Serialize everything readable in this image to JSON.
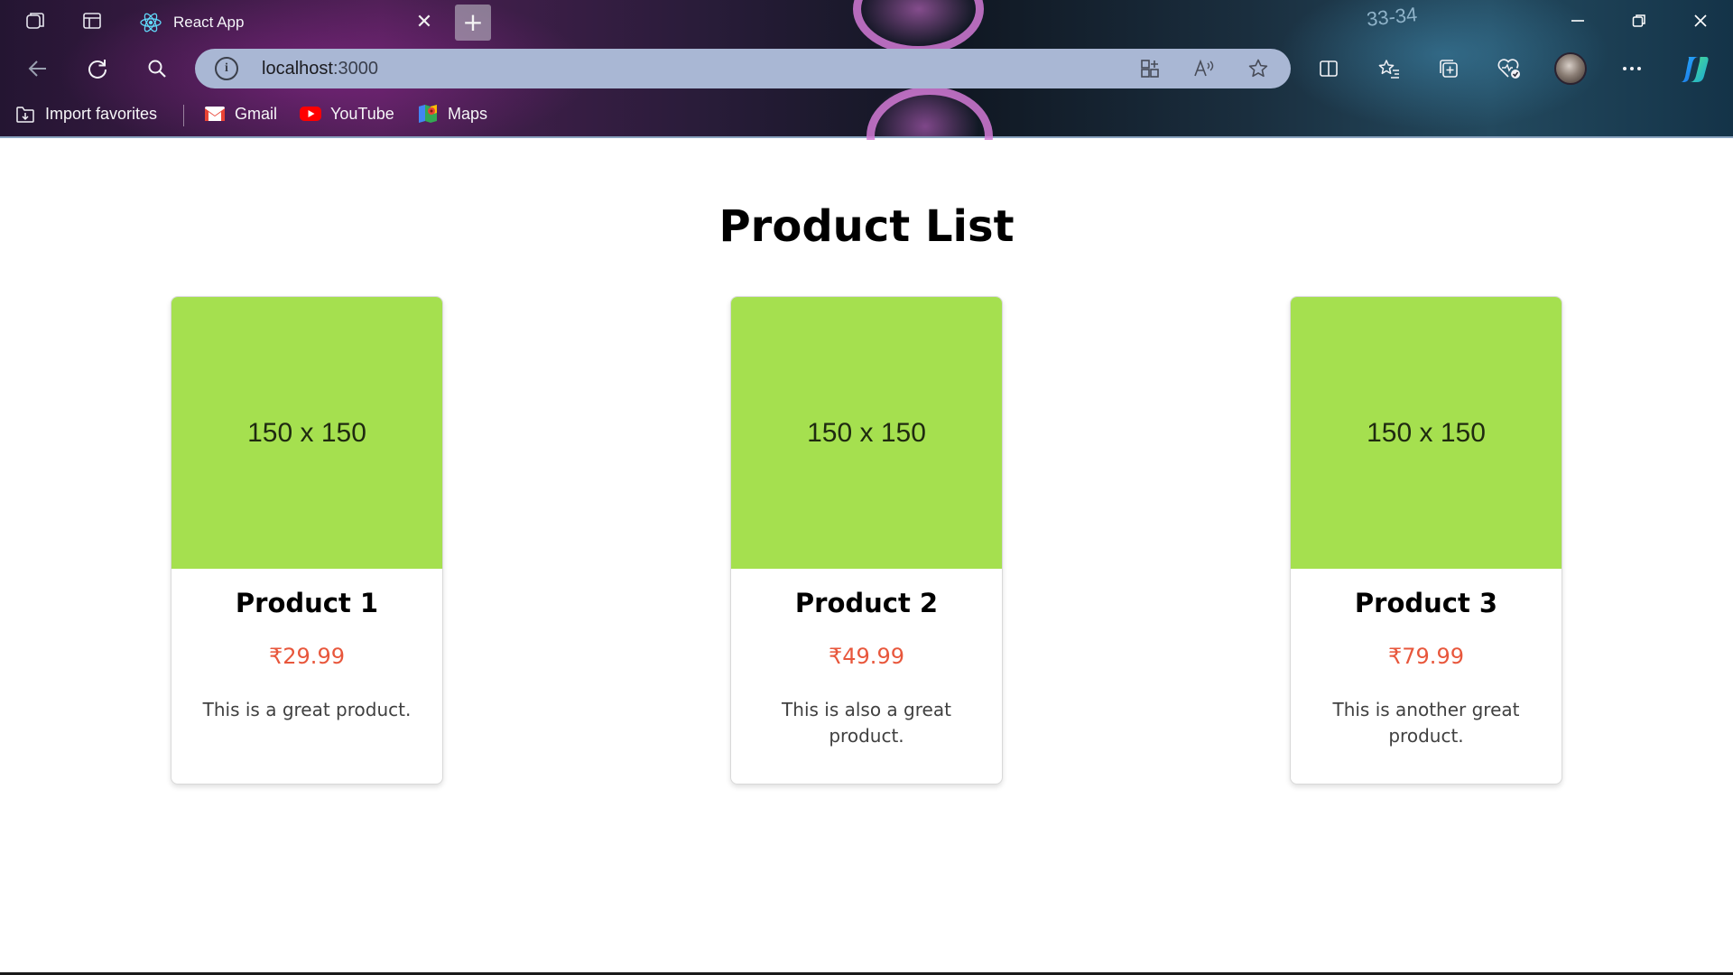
{
  "browser": {
    "tab": {
      "title": "React App",
      "close": "✕"
    },
    "new_tab": "+",
    "address": {
      "host": "localhost",
      "port": ":3000"
    },
    "background_text": "33-34",
    "window_controls": {
      "minimize": "—",
      "restore": "❐",
      "close": "✕"
    },
    "bookmarks": [
      {
        "label": "Import favorites",
        "icon": "import-favorites-icon"
      },
      {
        "label": "Gmail",
        "icon": "gmail-icon"
      },
      {
        "label": "YouTube",
        "icon": "youtube-icon"
      },
      {
        "label": "Maps",
        "icon": "maps-icon"
      }
    ],
    "colors": {
      "address_bar": "#a9b7d4",
      "gmail_red": "#ea4335",
      "youtube_red": "#ff0000"
    }
  },
  "page": {
    "title": "Product List",
    "products": [
      {
        "image_text": "150 x 150",
        "name": "Product 1",
        "price": "₹29.99",
        "description": "This is a great product."
      },
      {
        "image_text": "150 x 150",
        "name": "Product 2",
        "price": "₹49.99",
        "description": "This is also a great product."
      },
      {
        "image_text": "150 x 150",
        "name": "Product 3",
        "price": "₹79.99",
        "description": "This is another great product."
      }
    ],
    "colors": {
      "image_bg": "#a5e04f",
      "price": "#e8573c"
    }
  }
}
